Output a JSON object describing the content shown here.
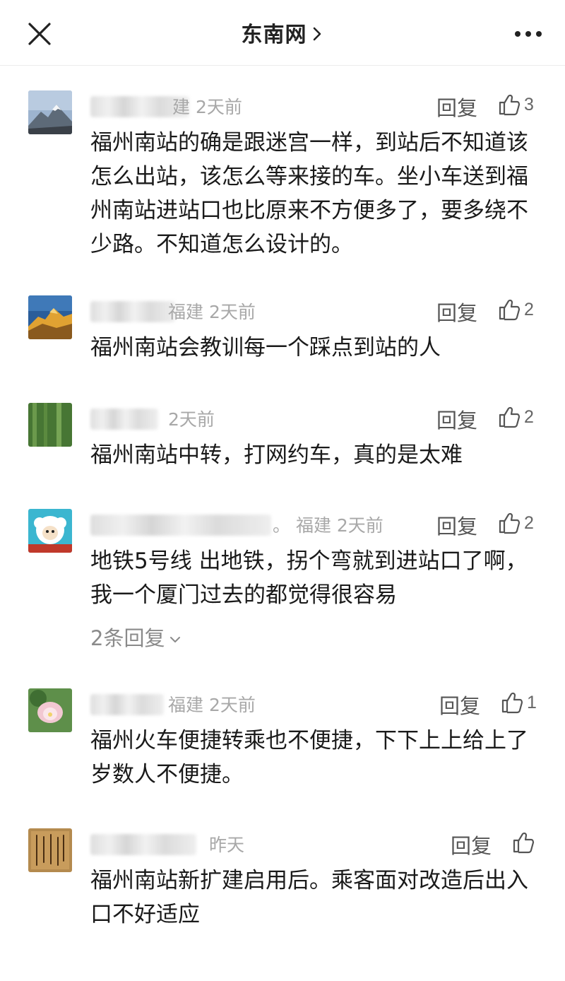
{
  "header": {
    "title": "东南网",
    "title_chevron": "chevron-right-icon",
    "close_icon": "close-icon",
    "more_icon": "more-dots-icon"
  },
  "comments": [
    {
      "meta": "建  2天前",
      "text": "福州南站的确是跟迷宫一样，到站后不知道该怎么出站，该怎么等来接的车。坐小车送到福州南站进站口也比原来不方便多了，要多绕不少路。不知道怎么设计的。",
      "reply_label": "回复",
      "likes": "3"
    },
    {
      "meta": "福建  2天前",
      "text": "福州南站会教训每一个踩点到站的人",
      "reply_label": "回复",
      "likes": "2"
    },
    {
      "meta": "2天前",
      "text": "福州南站中转，打网约车，真的是太难",
      "reply_label": "回复",
      "likes": "2"
    },
    {
      "meta": "。  福建  2天前",
      "text": "地铁5号线 出地铁，拐个弯就到进站口了啊，我一个厦门过去的都觉得很容易",
      "reply_label": "回复",
      "likes": "2",
      "replies_toggle": "2条回复"
    },
    {
      "meta": "福建  2天前",
      "text": "福州火车便捷转乘也不便捷，下下上上给上了岁数人不便捷。",
      "reply_label": "回复",
      "likes": "1"
    },
    {
      "meta": "昨天",
      "text": "福州南站新扩建启用后。乘客面对改造后出入口不好适应",
      "reply_label": "回复",
      "likes": ""
    }
  ],
  "colors": {
    "text": "#1a1a1a",
    "meta": "#a8a8a8",
    "action": "#555555",
    "divider": "#ececec"
  }
}
